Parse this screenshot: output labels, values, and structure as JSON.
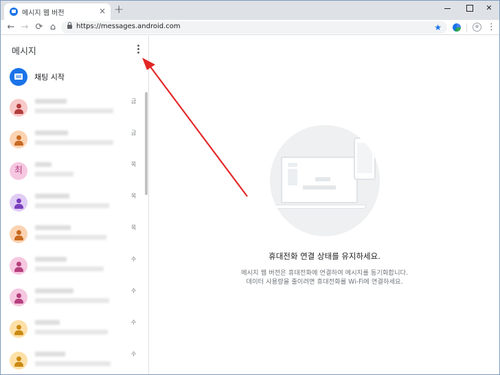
{
  "browser": {
    "tab_title": "메시지 웹 버전",
    "tab_close": "×",
    "new_tab": "+",
    "url": "https://messages.android.com",
    "back": "←",
    "forward": "→",
    "reload": "⟳",
    "home": "⌂",
    "star": "★",
    "menu": "⋮"
  },
  "sidebar": {
    "title": "메시지",
    "start_chat_label": "채팅 시작",
    "conversations": [
      {
        "date": "금",
        "avatar_type": "person",
        "avatar_bg": "#f8c9c9",
        "avatar_fg": "#b33c3c"
      },
      {
        "date": "금",
        "avatar_type": "person",
        "avatar_bg": "#fbd3b2",
        "avatar_fg": "#c86a21"
      },
      {
        "date": "목",
        "avatar_type": "letter",
        "avatar_letter": "최",
        "avatar_bg": "#f6c7e0",
        "avatar_fg": "#b5407e"
      },
      {
        "date": "목",
        "avatar_type": "person",
        "avatar_bg": "#e0cdf4",
        "avatar_fg": "#7b3fbe"
      },
      {
        "date": "목",
        "avatar_type": "person",
        "avatar_bg": "#fbd3b2",
        "avatar_fg": "#c86a21"
      },
      {
        "date": "수",
        "avatar_type": "person",
        "avatar_bg": "#f6c7e0",
        "avatar_fg": "#b5407e"
      },
      {
        "date": "수",
        "avatar_type": "person",
        "avatar_bg": "#f6c7e0",
        "avatar_fg": "#b5407e"
      },
      {
        "date": "수",
        "avatar_type": "person",
        "avatar_bg": "#fde0a8",
        "avatar_fg": "#c98a12"
      },
      {
        "date": "수",
        "avatar_type": "person",
        "avatar_bg": "#fde0a8",
        "avatar_fg": "#c98a12"
      }
    ]
  },
  "main": {
    "heading": "휴대전화 연결 상태를 유지하세요.",
    "description_line1": "메시지 웹 버전은 휴대전화에 연결하여 메시지를 동기화합니다.",
    "description_line2": "데이터 사용량을 줄이려면 휴대전화를 Wi-Fi에 연결하세요."
  },
  "colors": {
    "accent": "#1a73e8",
    "annotation_arrow": "#e32626"
  }
}
